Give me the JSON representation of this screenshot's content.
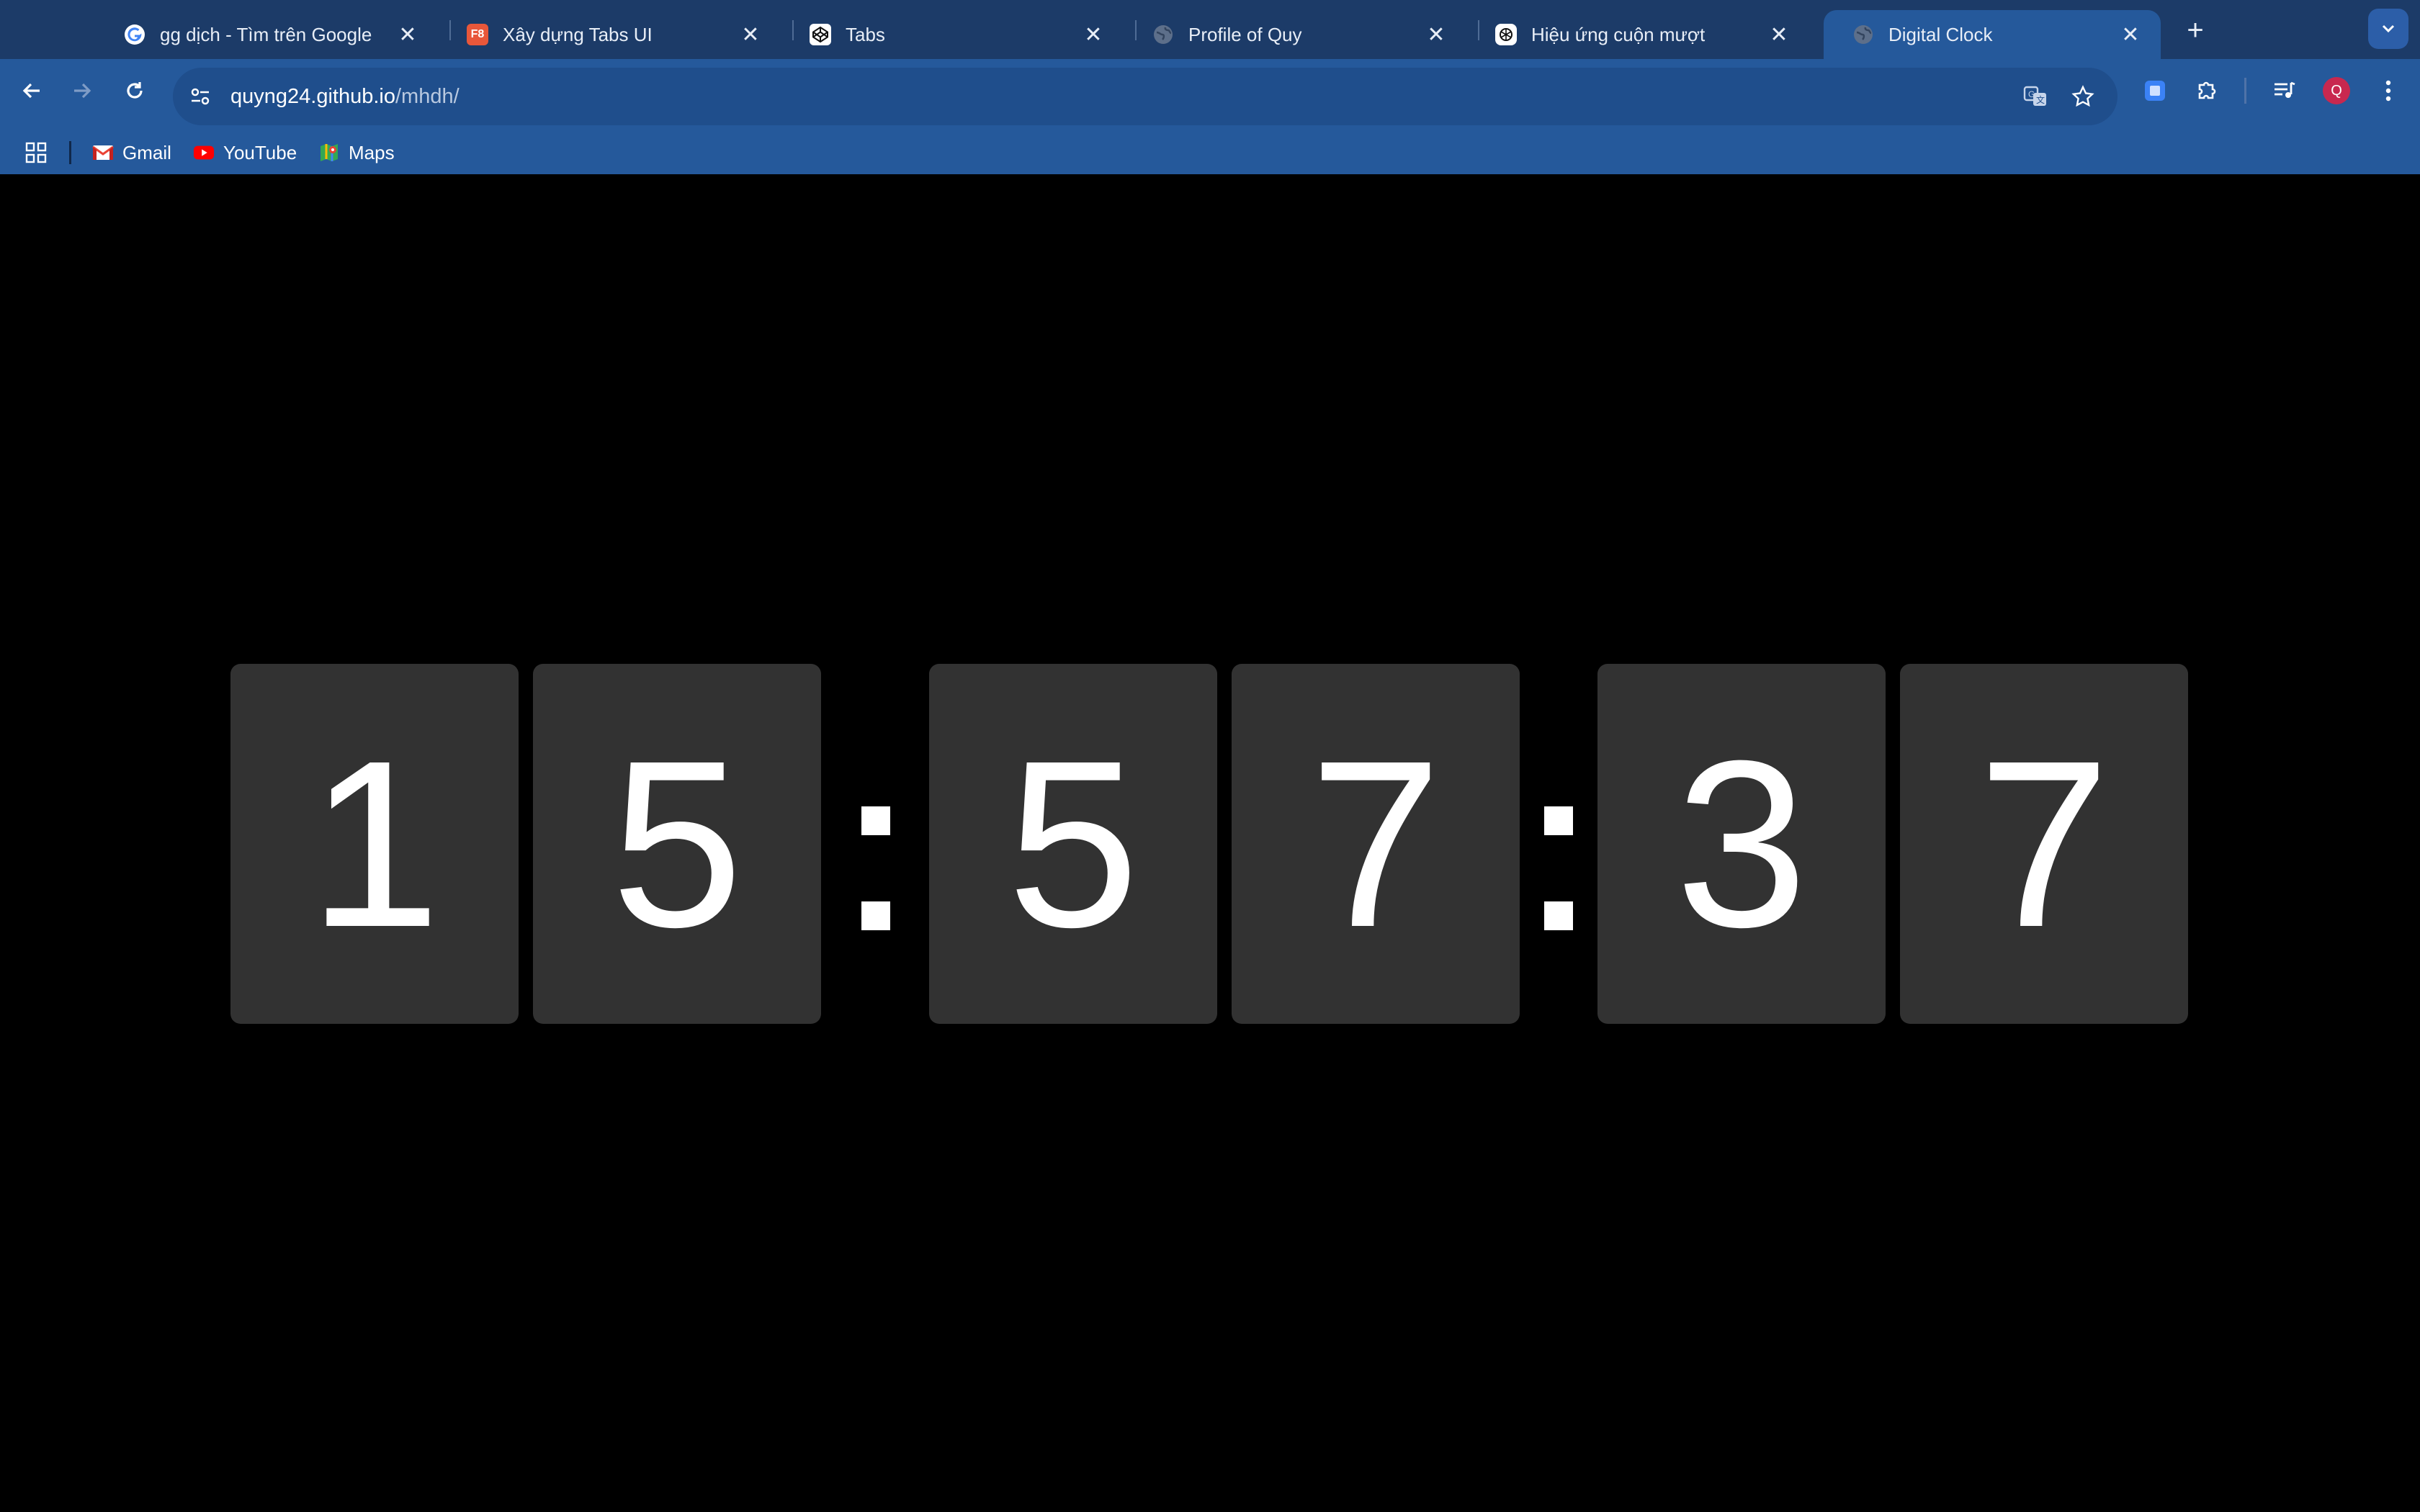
{
  "browser": {
    "tabs": [
      {
        "title": "gg dịch - Tìm trên Google",
        "icon": "google-icon"
      },
      {
        "title": "Xây dựng Tabs UI",
        "icon": "f8-icon",
        "icon_text": "F8"
      },
      {
        "title": "Tabs",
        "icon": "codepen-icon"
      },
      {
        "title": "Profile of Quy",
        "icon": "globe-icon"
      },
      {
        "title": "Hiệu ứng cuộn mượt",
        "icon": "openai-icon"
      },
      {
        "title": "Digital Clock",
        "icon": "globe-icon",
        "active": true
      }
    ],
    "address": {
      "host": "quyng24.github.io",
      "path": "/mhdh/"
    },
    "bookmarks": [
      {
        "label": "Gmail",
        "icon": "gmail-icon"
      },
      {
        "label": "YouTube",
        "icon": "youtube-icon"
      },
      {
        "label": "Maps",
        "icon": "maps-icon"
      }
    ],
    "profile_initial": "Q",
    "colors": {
      "tabstrip": "#1c3b68",
      "toolbar": "#25599b",
      "accent": "#c8284f"
    }
  },
  "clock": {
    "digits": [
      "1",
      "5",
      "5",
      "7",
      "3",
      "7"
    ],
    "separator": ":",
    "card_color": "#323232",
    "text_color": "#ffffff"
  }
}
